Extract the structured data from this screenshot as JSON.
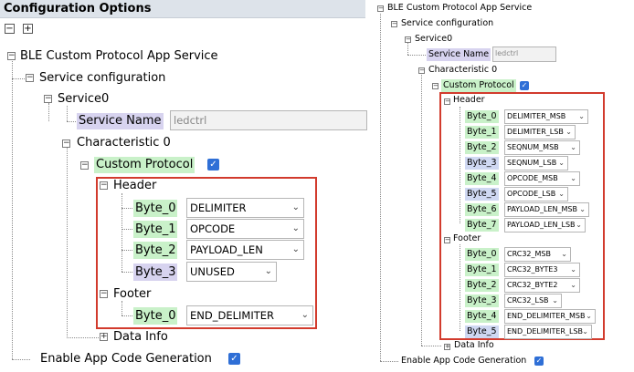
{
  "left": {
    "panel_title": "Configuration Options",
    "collapse_all_symbol": "−",
    "expand_all_symbol": "+",
    "root_label": "BLE Custom Protocol App Service",
    "service_configuration_label": "Service configuration",
    "service0_label": "Service0",
    "service_name_label": "Service Name",
    "service_name_value": "ledctrl",
    "characteristic_label": "Characteristic 0",
    "custom_protocol_label": "Custom Protocol",
    "header_label": "Header",
    "header_bytes": [
      {
        "label": "Byte_0",
        "value": "DELIMITER"
      },
      {
        "label": "Byte_1",
        "value": "OPCODE"
      },
      {
        "label": "Byte_2",
        "value": "PAYLOAD_LEN"
      },
      {
        "label": "Byte_3",
        "value": "UNUSED"
      }
    ],
    "footer_label": "Footer",
    "footer_bytes": [
      {
        "label": "Byte_0",
        "value": "END_DELIMITER"
      }
    ],
    "data_info_label": "Data Info",
    "enable_app_code_label": "Enable App Code Generation",
    "check_mark": "✓",
    "caret": "⌄",
    "minus": "−",
    "plus": "+"
  },
  "right": {
    "root_label": "BLE Custom Protocol App Service",
    "service_configuration_label": "Service configuration",
    "service0_label": "Service0",
    "service_name_label": "Service Name",
    "service_name_value": "ledctrl",
    "characteristic_label": "Characteristic 0",
    "custom_protocol_label": "Custom Protocol",
    "header_label": "Header",
    "header_bytes": [
      {
        "label": "Byte_0",
        "value": "DELIMITER_MSB"
      },
      {
        "label": "Byte_1",
        "value": "DELIMITER_LSB"
      },
      {
        "label": "Byte_2",
        "value": "SEQNUM_MSB"
      },
      {
        "label": "Byte_3",
        "value": "SEQNUM_LSB"
      },
      {
        "label": "Byte_4",
        "value": "OPCODE_MSB"
      },
      {
        "label": "Byte_5",
        "value": "OPCODE_LSB"
      },
      {
        "label": "Byte_6",
        "value": "PAYLOAD_LEN_MSB"
      },
      {
        "label": "Byte_7",
        "value": "PAYLOAD_LEN_LSB"
      }
    ],
    "footer_label": "Footer",
    "footer_bytes": [
      {
        "label": "Byte_0",
        "value": "CRC32_MSB"
      },
      {
        "label": "Byte_1",
        "value": "CRC32_BYTE3"
      },
      {
        "label": "Byte_2",
        "value": "CRC32_BYTE2"
      },
      {
        "label": "Byte_3",
        "value": "CRC32_LSB"
      },
      {
        "label": "Byte_4",
        "value": "END_DELIMITER_MSB"
      },
      {
        "label": "Byte_5",
        "value": "END_DELIMITER_LSB"
      }
    ],
    "data_info_label": "Data Info",
    "enable_app_code_label": "Enable App Code Generation",
    "check_mark": "✓",
    "caret": "⌄",
    "minus": "−",
    "plus": "+"
  },
  "colors": {
    "highlight_box": "#d23b2d",
    "checkbox": "#2f6fd6",
    "label_green": "#c9f1c9",
    "label_purple": "#d7d3ef",
    "label_blue": "#cfd8f2"
  }
}
